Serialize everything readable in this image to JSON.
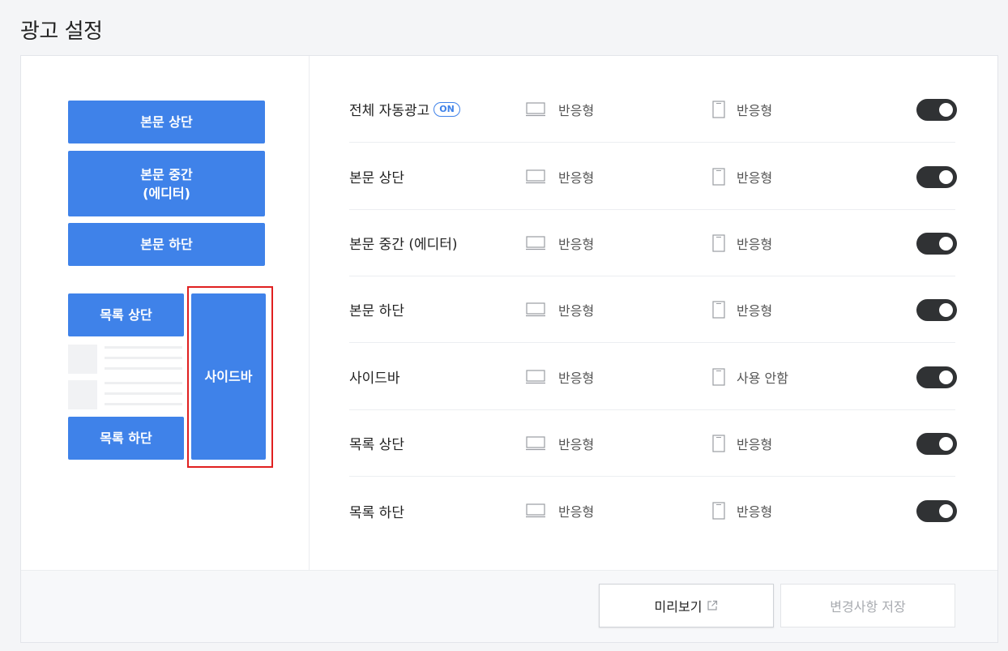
{
  "page": {
    "title": "광고 설정"
  },
  "preview": {
    "blocks": {
      "body_top": "본문 상단",
      "body_middle": "본문 중간\n(에디터)",
      "body_bottom": "본문 하단",
      "list_top": "목록 상단",
      "list_bottom": "목록 하단",
      "sidebar": "사이드바"
    },
    "colors": {
      "block": "#3f82e9",
      "selected_frame": "#e02020"
    }
  },
  "settings": {
    "rows": [
      {
        "label": "전체 자동광고",
        "badge": "ON",
        "pc": "반응형",
        "mobile": "반응형",
        "enabled": true
      },
      {
        "label": "본문 상단",
        "pc": "반응형",
        "mobile": "반응형",
        "enabled": true
      },
      {
        "label": "본문 중간 (에디터)",
        "pc": "반응형",
        "mobile": "반응형",
        "enabled": true
      },
      {
        "label": "본문 하단",
        "pc": "반응형",
        "mobile": "반응형",
        "enabled": true
      },
      {
        "label": "사이드바",
        "pc": "반응형",
        "mobile": "사용 안함",
        "enabled": true
      },
      {
        "label": "목록 상단",
        "pc": "반응형",
        "mobile": "반응형",
        "enabled": true
      },
      {
        "label": "목록 하단",
        "pc": "반응형",
        "mobile": "반응형",
        "enabled": true
      }
    ],
    "icons": {
      "pc": "monitor-icon",
      "mobile": "phone-icon"
    }
  },
  "footer": {
    "preview_label": "미리보기",
    "save_label": "변경사항 저장"
  }
}
